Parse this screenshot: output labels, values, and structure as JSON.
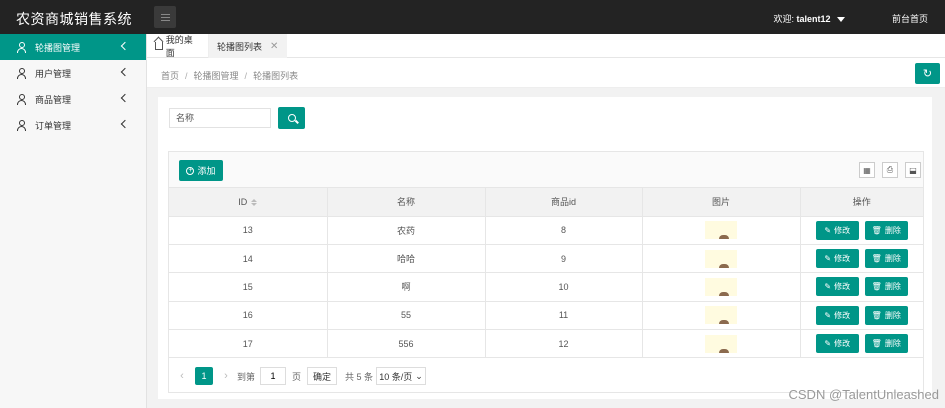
{
  "header": {
    "title": "农资商城销售系统",
    "welcome_prefix": "欢迎:",
    "username": "talent12",
    "home_link": "前台首页"
  },
  "sidebar": {
    "items": [
      {
        "label": "轮播图管理",
        "active": true
      },
      {
        "label": "用户管理",
        "active": false
      },
      {
        "label": "商品管理",
        "active": false
      },
      {
        "label": "订单管理",
        "active": false
      }
    ]
  },
  "tabs": {
    "home": "我的桌面",
    "active": "轮播图列表"
  },
  "breadcrumb": {
    "items": [
      "首页",
      "轮播图管理",
      "轮播图列表"
    ],
    "separator": "/"
  },
  "search": {
    "placeholder": "名称"
  },
  "toolbar": {
    "add_label": "添加"
  },
  "table": {
    "columns": [
      "ID",
      "名称",
      "商品id",
      "图片",
      "操作"
    ],
    "rows": [
      {
        "id": "13",
        "name": "农药",
        "product_id": "8"
      },
      {
        "id": "14",
        "name": "哈哈",
        "product_id": "9"
      },
      {
        "id": "15",
        "name": "啊",
        "product_id": "10"
      },
      {
        "id": "16",
        "name": "55",
        "product_id": "11"
      },
      {
        "id": "17",
        "name": "556",
        "product_id": "12"
      }
    ],
    "edit_label": "修改",
    "delete_label": "删除"
  },
  "pagination": {
    "current": "1",
    "goto_prefix": "到第",
    "goto_value": "1",
    "goto_suffix": "页",
    "confirm": "确定",
    "total": "共 5 条",
    "page_size": "10 条/页"
  },
  "watermark": "CSDN @TalentUnleashed",
  "colors": {
    "accent": "#009688",
    "header_bg": "#232323"
  },
  "icons": [
    "user-icon",
    "chevron-left-icon",
    "house-icon",
    "close-icon",
    "refresh-icon",
    "search-icon",
    "plus-circle-icon",
    "sort-icon",
    "pencil-icon",
    "trash-icon",
    "columns-icon",
    "print-icon",
    "export-icon"
  ]
}
